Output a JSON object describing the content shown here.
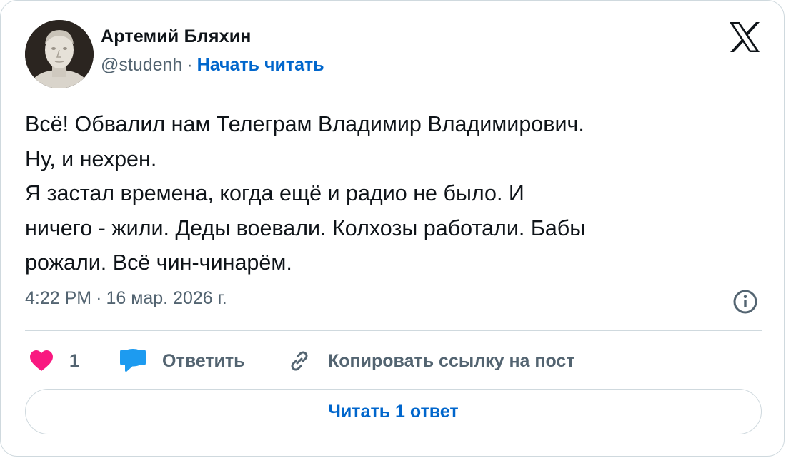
{
  "author": {
    "name": "Артемий Бляхин",
    "handle": "@studenh",
    "separator": "·",
    "follow_label": "Начать читать"
  },
  "tweet": {
    "text": "Всё! Обвалил нам Телеграм Владимир Владимирович.\nНу, и нехрен.\nЯ застал времена, когда ещё и радио не было. И\nничего - жили. Деды воевали. Колхозы работали. Бабы\nрожали. Всё чин-чинарём.",
    "time": "4:22 PM",
    "separator": "·",
    "date": "16 мар. 2026 г."
  },
  "actions": {
    "likes_count": "1",
    "reply_label": "Ответить",
    "copy_label": "Копировать ссылку на пост"
  },
  "read_replies_label": "Читать 1 ответ",
  "icons": {
    "logo": "x-logo-icon",
    "info": "info-icon",
    "like": "heart-icon",
    "reply": "speech-bubble-icon",
    "copy": "link-icon"
  },
  "colors": {
    "link": "#0066cc",
    "secondary_text": "#536471",
    "heart": "#f91880",
    "reply_bubble": "#1d9bf0",
    "border": "#cfd9de"
  }
}
